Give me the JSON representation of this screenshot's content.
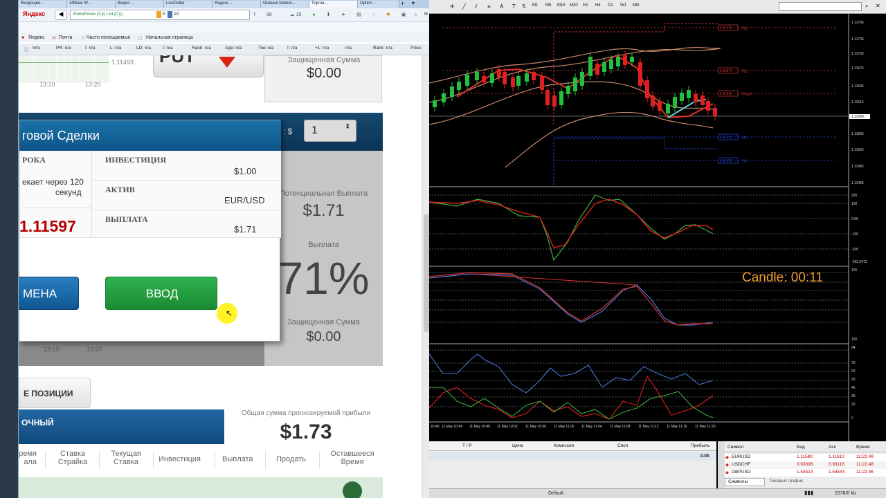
{
  "browser": {
    "tabs": [
      "Входящие...",
      "Affiliate W...",
      "Видео ...",
      "LiveDollar",
      "Яндекс...",
      "Мнения Market...",
      "Торгов...",
      "Option ..."
    ],
    "address": {
      "logo": "Яндекс",
      "site": "RoboForex (Cy) Ltd (Cy)",
      "count_a": "0",
      "count_b": "10",
      "count_c": "88",
      "count_d": "16"
    },
    "bookmarks": [
      "Яндекс",
      "Почта",
      "Часто посещаемые",
      "Начальная страница"
    ],
    "seo_bar": [
      "Info",
      "PR: n/a",
      "I: n/a",
      "L: n/a",
      "LD: n/a",
      "I: n/a",
      "Rank: n/a",
      "Age: n/a",
      "Twc n/a",
      "I: n/a",
      "+1: n/a",
      "n/a",
      "Rank: n/a",
      "Price:"
    ]
  },
  "page": {
    "top_chart": {
      "times": [
        "13:10",
        "13:20"
      ],
      "price": "1.11493"
    },
    "top_prot": {
      "label": "Защищенная Сумма",
      "value": "$0.00"
    },
    "top_btn_text": "PUT",
    "select_label": "а : $",
    "select_value": "1",
    "potential": {
      "label": "Потенциальная Выплата",
      "value": "$1.71"
    },
    "payout": {
      "label": "Выплата",
      "value": "71%"
    },
    "prot2": {
      "label": "Защищенная Сумма",
      "value": "$0.00"
    },
    "chart2_times": [
      "13:10",
      "13:20"
    ],
    "dialog": {
      "title": "говой Сделки",
      "srok_label": "РОКА",
      "srok_value_1": "екает через 120",
      "srok_value_2": "секунд",
      "price": "1.11597",
      "invest_label": "ИНВЕСТИЦИЯ",
      "invest_value": "$1.00",
      "asset_label": "АКТИВ",
      "asset_value": "EUR/USD",
      "payout_label": "ВЫПЛАТА",
      "payout_value": "$1.71",
      "cancel": "МЕНА",
      "enter": "ВВОД"
    },
    "positions_tab": "Е ПОЗИЦИИ",
    "blue_header": "ОЧНЫЙ",
    "total_label": "Общая сумма прогнозируемой прибыли",
    "total_value": "$1.73",
    "columns": [
      "ремя\nала",
      "Ставка\nСтрайка",
      "Текущая\nСтавка",
      "Инвестиция",
      "Выплата",
      "Продать",
      "Оставшееся\nВремя"
    ]
  },
  "mt4": {
    "timeframes": [
      "M1",
      "M5",
      "M15",
      "M30",
      "H1",
      "H4",
      "D1",
      "W1",
      "MN"
    ],
    "price_axis": [
      "1.11765",
      "1.11735",
      "1.11705",
      "1.11675",
      "1.11645",
      "1.11615",
      "1.11590",
      "1.11555",
      "1.11525",
      "1.11495",
      "1.11465"
    ],
    "levels": [
      {
        "name": "R2",
        "price": "1.11775"
      },
      {
        "name": "R1",
        "price": "1.11677"
      },
      {
        "name": "Pivot",
        "price": "1.11635"
      },
      {
        "name": "S1",
        "price": "1.11559"
      },
      {
        "name": "S2",
        "price": "1.11523"
      }
    ],
    "cci_axis": [
      "200",
      "100",
      "0.00",
      "-100",
      "-200",
      "-292.2472"
    ],
    "osc2_axis": [
      "106"
    ],
    "stoch_axis": [
      "100",
      "94",
      "70",
      "62",
      "50",
      "40",
      "30",
      "20",
      "0"
    ],
    "candle_timer": "Candle:  00:11",
    "time_axis": [
      "20:40",
      "11 May 10:44",
      "11 May 10:48",
      "11 May 10:52",
      "11 May 10:56",
      "11 May 11:00",
      "11 May 11:04",
      "11 May 11:08",
      "11 May 11:12",
      "11 May 11:16",
      "11 May 11:20"
    ],
    "terminal_cols": [
      "T / P",
      "Цена",
      "Комиссия",
      "Своп",
      "Прибыль"
    ],
    "terminal_total": "0.00",
    "market_cols": [
      "Символ",
      "Бид",
      "Аск",
      "Время"
    ],
    "market": [
      {
        "sym": "EURUSD",
        "bid": "1.11590",
        "ask": "1.11610",
        "time": "11:22:49"
      },
      {
        "sym": "USDCHF",
        "bid": "0.93096",
        "ask": "0.93116",
        "time": "11:22:48"
      },
      {
        "sym": "GBPUSD",
        "bid": "1.54514",
        "ask": "1.54544",
        "time": "11:22:46"
      }
    ],
    "market_tabs": [
      "Символы",
      "Тиковый график"
    ],
    "status_profile": "Default",
    "status_traffic": "1578/0 kb"
  },
  "colors": {
    "red_price": "#b30000",
    "green_btn": "#1e9a3a",
    "blue_btn": "#1b6aa8",
    "payout_panel": "#c6c6c6"
  }
}
